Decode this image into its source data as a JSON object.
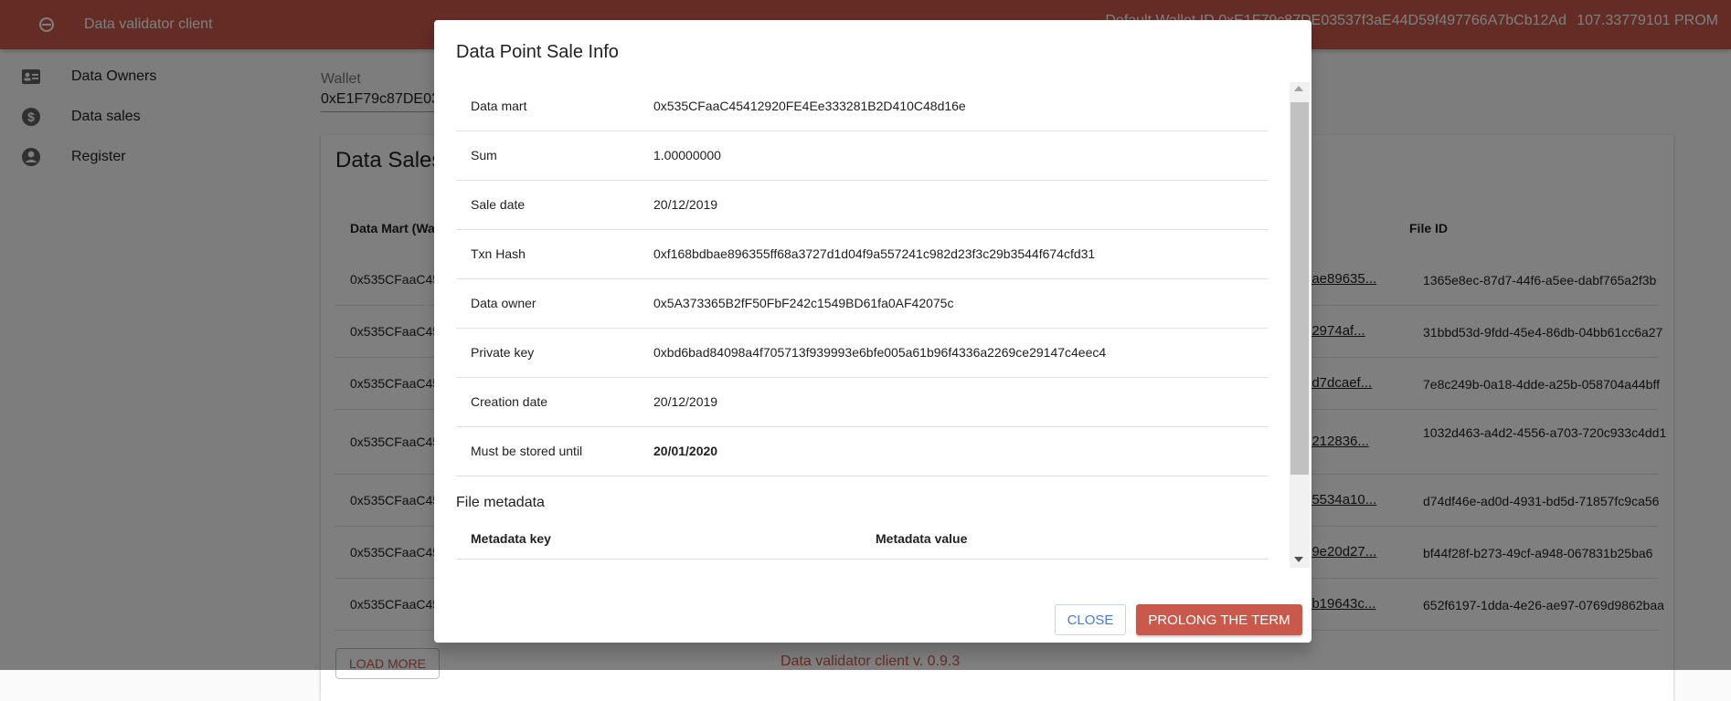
{
  "app": {
    "title": "Data validator client",
    "wallet_id": "Default Wallet ID 0xE1F79c87DE03537f3aE44D59f497766A7bCb12Ad",
    "balance": "107.33779101 PROM",
    "footer": "Data validator client v. 0.9.3"
  },
  "sidebar": {
    "items": [
      {
        "label": "Data Owners",
        "icon": "id-card-icon"
      },
      {
        "label": "Data sales",
        "icon": "dollar-icon"
      },
      {
        "label": "Register",
        "icon": "account-icon"
      }
    ]
  },
  "main": {
    "wallet_label": "Wallet",
    "wallet_value": "0xE1F79c87DE03537f3aE44D59f497766A7bCb12Ad",
    "card_title": "Data Sales",
    "columns": {
      "mart": "Data Mart (Wallet)",
      "file_id": "File ID"
    },
    "rows": [
      {
        "mart": "0x535CFaaC45412920FE4Ee333281B2D410C48d16e",
        "hash": "0x...ae89635...",
        "file_id": "1365e8ec-87d7-44f6-a5ee-dabf765a2f3b"
      },
      {
        "mart": "0x535CFaaC45412920FE4Ee333281B2D410C48d16e",
        "hash": "0x...2974af...",
        "file_id": "31bbd53d-9fdd-45e4-86db-04bb61cc6a27"
      },
      {
        "mart": "0x535CFaaC45412920FE4Ee333281B2D410C48d16e",
        "hash": "0x...d7dcaef...",
        "file_id": "7e8c249b-0a18-4dde-a25b-058704a44bff"
      },
      {
        "mart": "0x535CFaaC45412920FE4Ee333281B2D410C48d16e",
        "hash": "0x...212836...",
        "file_id": "1032d463-a4d2-4556-a703-720c933c4dd1"
      },
      {
        "mart": "0x535CFaaC45412920FE4Ee333281B2D410C48d16e",
        "hash": "0x...5534a10...",
        "file_id": "d74df46e-ad0d-4931-bd5d-71857fc9ca56"
      },
      {
        "mart": "0x535CFaaC45412920FE4Ee333281B2D410C48d16e",
        "hash": "0x...9e20d27...",
        "file_id": "bf44f28f-b273-49cf-a948-067831b25ba6"
      },
      {
        "mart": "0x535CFaaC45412920FE4Ee333281B2D410C48d16e",
        "hash": "0x...b19643c...",
        "file_id": "652f6197-1dda-4e26-ae97-0769d9862baa"
      }
    ],
    "load_more": "LOAD MORE"
  },
  "dialog": {
    "title": "Data Point Sale Info",
    "fields": [
      {
        "key": "Data mart",
        "value": "0x535CFaaC45412920FE4Ee333281B2D410C48d16e",
        "bold": false
      },
      {
        "key": "Sum",
        "value": "1.00000000",
        "bold": false
      },
      {
        "key": "Sale date",
        "value": "20/12/2019",
        "bold": false
      },
      {
        "key": "Txn Hash",
        "value": "0xf168bdbae896355ff68a3727d1d04f9a557241c982d23f3c29b3544f674cfd31",
        "bold": false
      },
      {
        "key": "Data owner",
        "value": "0x5A373365B2fF50FbF242c1549BD61fa0AF42075c",
        "bold": false
      },
      {
        "key": "Private key",
        "value": "0xbd6bad84098a4f705713f939993e6bfe005a61b96f4336a2269ce29147c4eec4",
        "bold": false
      },
      {
        "key": "Creation date",
        "value": "20/12/2019",
        "bold": false
      },
      {
        "key": "Must be stored until",
        "value": "20/01/2020",
        "bold": true
      }
    ],
    "metadata_title": "File metadata",
    "metadata_key_header": "Metadata key",
    "metadata_value_header": "Metadata value",
    "close_label": "CLOSE",
    "prolong_label": "PROLONG THE TERM"
  },
  "colors": {
    "accent": "#c9594b",
    "close_text": "#4a7ccf"
  }
}
